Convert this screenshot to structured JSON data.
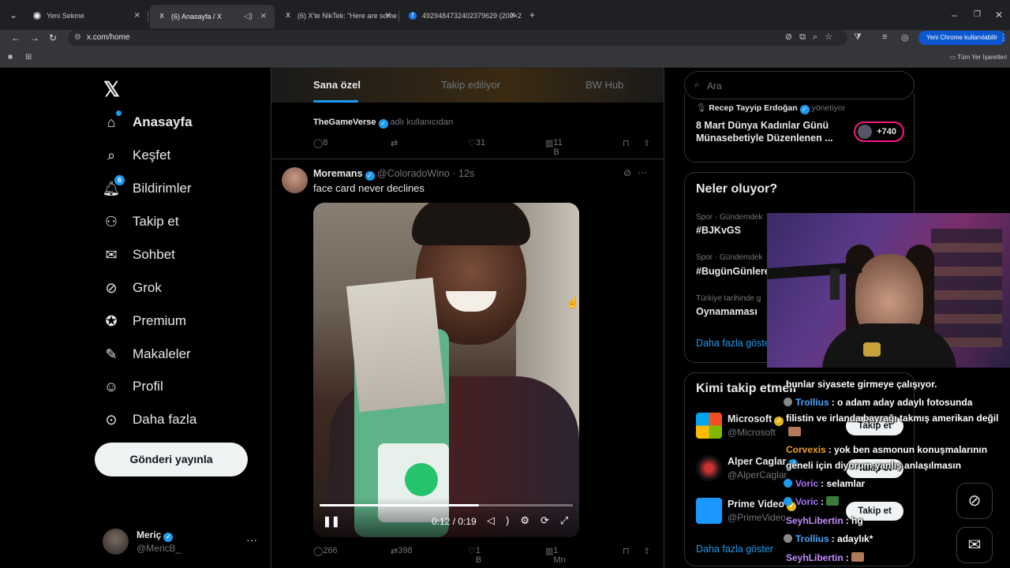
{
  "browser": {
    "tabs": [
      {
        "title": "Yeni Sekme",
        "icon": "chrome-icon"
      },
      {
        "title": "(6) Anasayfa / X",
        "icon": "x-logo-icon"
      },
      {
        "title": "(6) X'te NikTek: \"Here are some",
        "icon": "x-logo-icon"
      },
      {
        "title": "4929484732402379629 (200×2",
        "icon": "facebook-icon"
      }
    ],
    "url": "x.com/home",
    "chrome_button": "Yeni Chrome kullanılabilir",
    "bookmarks_all": "Tüm Yer İşaretleri"
  },
  "logo": "𝕏",
  "nav": [
    {
      "label": "Anasayfa",
      "icon": "home-icon",
      "glyph": "⌂",
      "active": true
    },
    {
      "label": "Keşfet",
      "icon": "search-icon",
      "glyph": "⌕"
    },
    {
      "label": "Bildirimler",
      "icon": "bell-icon",
      "glyph": "♫",
      "badge": "6"
    },
    {
      "label": "Takip et",
      "icon": "follow-icon",
      "glyph": "⚇"
    },
    {
      "label": "Sohbet",
      "icon": "mail-icon",
      "glyph": "✉"
    },
    {
      "label": "Grok",
      "icon": "grok-icon",
      "glyph": "⊘"
    },
    {
      "label": "Premium",
      "icon": "premium-icon",
      "glyph": "✪"
    },
    {
      "label": "Makaleler",
      "icon": "articles-icon",
      "glyph": "✎"
    },
    {
      "label": "Profil",
      "icon": "person-icon",
      "glyph": "☺"
    },
    {
      "label": "Daha fazla",
      "icon": "more-circle-icon",
      "glyph": "⋯"
    }
  ],
  "post_button": "Gönderi yayınla",
  "me": {
    "name": "Meriç",
    "handle": "@MericB_",
    "more": "···"
  },
  "feed": {
    "tabs": [
      "Sana özel",
      "Takip ediliyor",
      "BW Hub"
    ],
    "prev": {
      "by_name": "TheGameVerse",
      "by_suffix": "adlı kullanıcıdan",
      "replies": "8",
      "likes": "31",
      "views": "11 B"
    },
    "tweet": {
      "name": "Moremans",
      "handle": "@ColoradoWino",
      "time": "· 12s",
      "text": "face card never declines",
      "video_time": "0:12 / 0:19",
      "video_progress": 0.63,
      "replies": "266",
      "retweets": "398",
      "likes": "1 B",
      "views": "1 Mn"
    }
  },
  "right": {
    "search_placeholder": "Ara",
    "spotlight": {
      "host": "Recep Tayyip Erdoğan",
      "host_suffix": "yönetiyor",
      "title": "8 Mart Dünya Kadınlar Günü Münasebetiyle Düzenlenen ...",
      "count": "+740"
    },
    "trends_title": "Neler oluyor?",
    "trends": [
      {
        "category": "Spor · Gündemdek",
        "name": "#BJKvGS"
      },
      {
        "category": "Spor · Gündemdek",
        "name": "#BugünGünlere"
      },
      {
        "category": "Türkiye tarihinde g",
        "name": "Oynamaması"
      }
    ],
    "trends_more": "Daha fazla göste",
    "who_title": "Kimi takip etmeli",
    "who": [
      {
        "name": "Microsoft",
        "handle": "@Microsoft",
        "button": "Takip et"
      },
      {
        "name": "Alper Caglar",
        "handle": "@AlperCaglar",
        "button": "Takip et"
      },
      {
        "name": "Prime Video",
        "handle": "@PrimeVideo",
        "button": "Takip et"
      }
    ],
    "who_more": "Daha fazla göster"
  },
  "chat": [
    {
      "user": "",
      "text": "bunlar siyasete girmeye çalışıyor.",
      "color": "#ffffff"
    },
    {
      "user": "Trollius",
      "text": ": o adam aday adaylı fotosunda",
      "color": "#4aa3ff"
    },
    {
      "user": "",
      "text": "filistin ve irlanda bayrağı takmış amerikan değil",
      "color": "#ffffff"
    },
    {
      "user": "Corvexis",
      "text": ": yok ben asmonun konuşmalarının",
      "color": "#f0a020"
    },
    {
      "user": "",
      "text": "geneli için diyorum yanlış anlaşılmasın",
      "color": "#ffffff"
    },
    {
      "user": "Voric",
      "text": ": selamlar",
      "color": "#a970ff"
    },
    {
      "user": "Voric",
      "text": ":",
      "color": "#a970ff"
    },
    {
      "user": "SeyhLibertin",
      "text": ": hg",
      "color": "#c58bff"
    },
    {
      "user": "Trollius",
      "text": ": adaylık*",
      "color": "#4aa3ff"
    },
    {
      "user": "SeyhLibertin",
      "text": ":",
      "color": "#c58bff"
    }
  ]
}
